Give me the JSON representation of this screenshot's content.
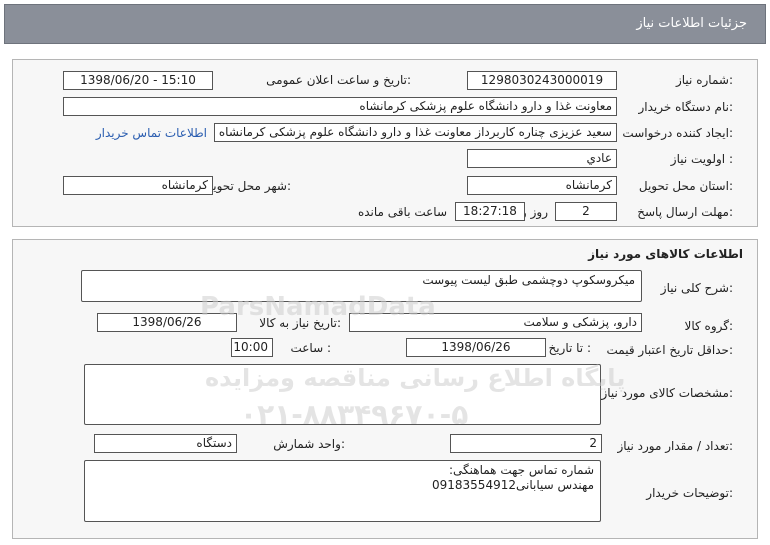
{
  "header": {
    "title": "جزئیات اطلاعات نیاز"
  },
  "info": {
    "need_number_label": "شماره نیاز:",
    "need_number": "1298030243000019",
    "announce_label": "تاریخ و ساعت اعلان عمومی:",
    "announce_value": "1398/06/20 - 15:10",
    "buyer_label": "نام دستگاه خریدار:",
    "buyer_value": "معاونت غذا و دارو دانشگاه علوم پزشکی کرمانشاه",
    "creator_label": "ایجاد کننده درخواست:",
    "creator_value": "سعید عزیزی چناره کاربرداز معاونت غذا و دارو دانشگاه علوم پزشکی کرمانشاه",
    "contact_link": "اطلاعات تماس خریدار",
    "priority_label": "اولویت نیاز :",
    "priority_value": "عادي",
    "province_label": "استان محل تحویل:",
    "province_value": "کرمانشاه",
    "city_label": "شهر محل تحویل:",
    "city_value": "کرمانشاه",
    "deadline_label": "مهلت ارسال پاسخ:",
    "days_value": "2",
    "days_label": "روز و",
    "time_value": "18:27:18",
    "time_label": "ساعت باقی مانده"
  },
  "goods": {
    "section_title": "اطلاعات کالاهای مورد نیاز",
    "summary_label": "شرح کلی نیاز:",
    "summary_value": "میکروسکوپ دوچشمی طبق لیست پیوست",
    "group_label": "گروه کالا:",
    "group_value": "دارو، پزشکی و سلامت",
    "need_date_label": "تاریخ نیاز به کالا:",
    "need_date_value": "1398/06/26",
    "validity_label": "حداقل تاریخ اعتبار قیمت:",
    "until_date_label": "تا تاریخ :",
    "until_date_value": "1398/06/26",
    "hour_label": "ساعت :",
    "hour_value": "10:00",
    "specs_label": "مشخصات کالای مورد نیاز:",
    "specs_value": "",
    "qty_label": "تعداد / مقدار مورد نیاز:",
    "qty_value": "2",
    "unit_label": "واحد شمارش:",
    "unit_value": "دستگاه",
    "buyer_notes_label": "توضیحات خریدار:",
    "buyer_notes_line1": "شماره تماس جهت هماهنگی:",
    "buyer_notes_line2": "مهندس سیابانی09183554912"
  },
  "watermark": {
    "brand": "ParsNamadData",
    "line1": "پایگاه اطلاع رسانی مناقصه ومزایده",
    "phone": "۰۲۱-۸۸۳۴۹۶۷۰-۵"
  }
}
